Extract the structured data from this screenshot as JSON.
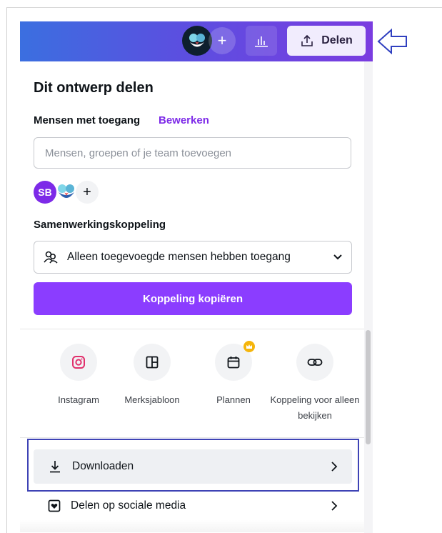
{
  "header": {
    "share_label": "Delen",
    "plus_symbol": "+",
    "icons": [
      "team-logo-icon",
      "bar-chart-icon",
      "upload-share-icon",
      "left-arrow-indicator-icon"
    ],
    "gradient_colors": [
      "#3b6fe0",
      "#7a3ce0"
    ]
  },
  "panel": {
    "title": "Dit ontwerp delen",
    "access_label": "Mensen met toegang",
    "edit_link": "Bewerken",
    "people_placeholder": "Mensen, groepen of je team toevoegen",
    "user_initials": "SB",
    "add_person": "+",
    "collab_label": "Samenwerkingskoppeling",
    "collab_value": "Alleen toegevoegde mensen hebben toegang",
    "copy_button": "Koppeling kopiëren",
    "accent_color": "#8b3dff"
  },
  "share_options": [
    {
      "label": "Instagram",
      "icon": "instagram-icon"
    },
    {
      "label": "Merksjabloon",
      "icon": "template-icon"
    },
    {
      "label": "Plannen",
      "icon": "calendar-icon",
      "premium": true
    },
    {
      "label": "Koppeling voor alleen bekijken",
      "icon": "link-icon"
    }
  ],
  "rows": {
    "download": "Downloaden",
    "social": "Delen op sociale media"
  }
}
